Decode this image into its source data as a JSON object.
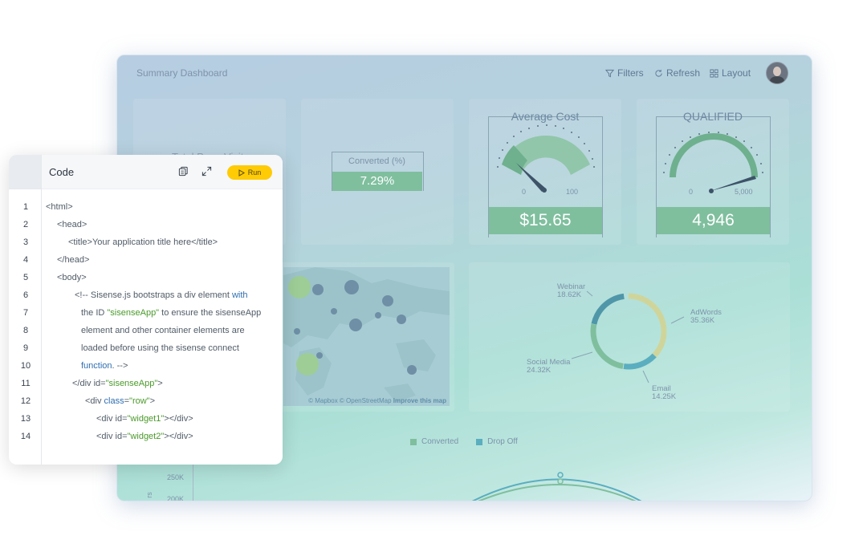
{
  "dashboard": {
    "title": "Summary Dashboard",
    "toolbar": {
      "filters": "Filters",
      "refresh": "Refresh",
      "layout": "Layout"
    },
    "kpi_partial_label": "Total Page Visits",
    "converted": {
      "label": "Converted (%)",
      "value": "7.29%"
    },
    "gauge1": {
      "title": "Average Cost",
      "min": "0",
      "max": "100",
      "value": "$15.65"
    },
    "gauge2": {
      "title": "QUALIFIED",
      "min": "0",
      "max": "5,000",
      "value": "4,946"
    },
    "map_credit": {
      "mapbox": "© Mapbox",
      "osm": "© OpenStreetMap",
      "improve": "Improve this map"
    },
    "donut": {
      "webinar": {
        "label": "Webinar",
        "value": "18.62K"
      },
      "adwords": {
        "label": "AdWords",
        "value": "35.36K"
      },
      "social": {
        "label": "Social Media",
        "value": "24.32K"
      },
      "email": {
        "label": "Email",
        "value": "14.25K"
      }
    },
    "legend": {
      "converted": "Converted",
      "dropoff": "Drop Off"
    },
    "axis": {
      "y1": "250K",
      "y2": "200K",
      "ylabel": "rs"
    }
  },
  "code_panel": {
    "title": "Code",
    "run_label": "Run",
    "lines": [
      {
        "n": "1"
      },
      {
        "n": "2"
      },
      {
        "n": "3"
      },
      {
        "n": "4"
      },
      {
        "n": "5"
      },
      {
        "n": "6"
      },
      {
        "n": "7"
      },
      {
        "n": "8"
      },
      {
        "n": "9"
      },
      {
        "n": "10"
      },
      {
        "n": "11"
      },
      {
        "n": "12"
      },
      {
        "n": "13"
      },
      {
        "n": "14"
      }
    ],
    "code": {
      "l1": "<html>",
      "l2": "<head>",
      "l3": "<title>Your application title here</title>",
      "l4": "</head>",
      "l5": "<body>",
      "l6a": "<!-- Sisense.js bootstraps a div element ",
      "l6b": "with",
      "l7a": "the ID ",
      "l7b": "\"sisenseApp\"",
      "l7c": " to ensure the sisenseApp",
      "l8": "element and other container elements are",
      "l9": "loaded before using the sisense connect",
      "l10a": "function",
      "l10b": ". -->",
      "l11a": "</div id=",
      "l11b": "\"sisenseApp\"",
      "l11c": ">",
      "l12a": "<div ",
      "l12b": "class",
      "l12c": "=",
      "l12d": "\"row\"",
      "l12e": ">",
      "l13a": "<div id=",
      "l13b": "\"widget1\"",
      "l13c": "></div>",
      "l14a": "<div id=",
      "l14b": "\"widget2\"",
      "l14c": "></div>"
    }
  },
  "colors": {
    "accent_green": "#7fbf9e",
    "run_button": "#ffcb05",
    "keyword": "#2f6fb0",
    "string": "#4a9a2a"
  }
}
